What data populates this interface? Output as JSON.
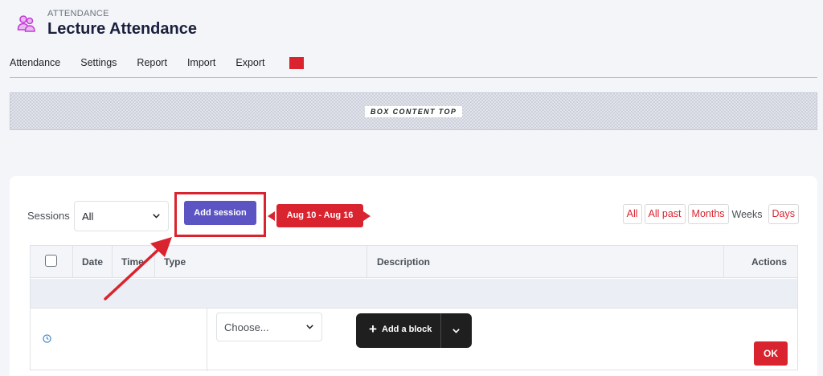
{
  "header": {
    "kicker": "ATTENDANCE",
    "title": "Lecture Attendance",
    "icon": "attendance-people-icon"
  },
  "nav": {
    "items": [
      "Attendance",
      "Settings",
      "Report",
      "Import",
      "Export"
    ]
  },
  "box_top": {
    "label": "BOX CONTENT TOP"
  },
  "sessions": {
    "label": "Sessions",
    "selected": "All",
    "add_button": "Add session",
    "date_range": "Aug 10 - Aug 16"
  },
  "filters": {
    "all": "All",
    "all_past": "All past",
    "months": "Months",
    "weeks": "Weeks",
    "days": "Days"
  },
  "table": {
    "columns": {
      "date": "Date",
      "time": "Time",
      "type": "Type",
      "description": "Description",
      "actions": "Actions"
    },
    "choose_placeholder": "Choose...",
    "ok_label": "OK"
  },
  "add_block": {
    "label": "Add a block"
  },
  "colors": {
    "accent_red": "#d9232e",
    "primary_button": "#5b54c2",
    "title_dark": "#1a1f3d"
  }
}
